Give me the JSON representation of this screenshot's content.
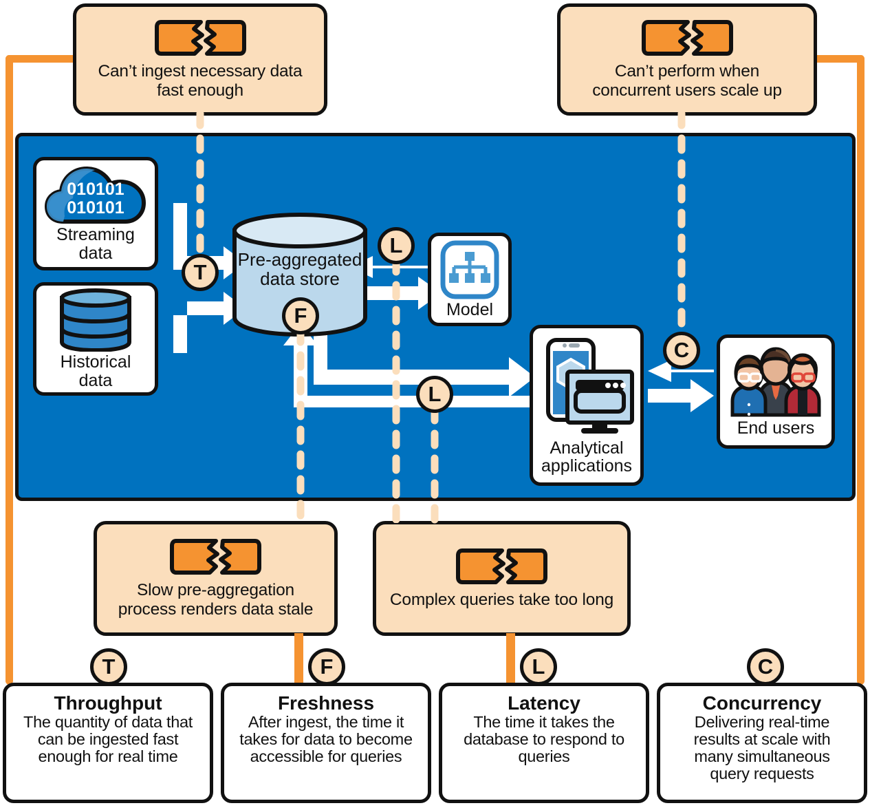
{
  "colors": {
    "orange": "#F59331",
    "peach": "#FBDEBC",
    "blue": "#0072BF",
    "light_blue": "#BBD8EC",
    "ink": "#111111",
    "icon_blue": "#4A90C4"
  },
  "problem_callouts": [
    {
      "id": "ingest",
      "icon": "broken-brick-icon",
      "text": "Can’t ingest necessary data\nfast enough"
    },
    {
      "id": "concurrency",
      "icon": "broken-brick-icon",
      "text": "Can’t perform when\nconcurrent users scale up"
    },
    {
      "id": "preaggregation",
      "icon": "broken-brick-icon",
      "text": "Slow pre-aggregation\nprocess renders data stale"
    },
    {
      "id": "queries",
      "icon": "broken-brick-icon",
      "text": "Complex queries take too long"
    }
  ],
  "architecture": {
    "nodes": [
      {
        "id": "streaming",
        "icon": "cloud-data-icon",
        "label": "Streaming\ndata",
        "binary_text_line1": "010101",
        "binary_text_line2": "010101"
      },
      {
        "id": "historical",
        "icon": "database-icon",
        "label": "Historical\ndata"
      },
      {
        "id": "datastore",
        "icon": "cylinder-icon",
        "label": "Pre-aggregated\ndata store"
      },
      {
        "id": "model",
        "icon": "hierarchy-icon",
        "label": "Model"
      },
      {
        "id": "apps",
        "icon": "devices-icon",
        "label": "Analytical\napplications"
      },
      {
        "id": "endusers",
        "icon": "people-group-icon",
        "label": "End users"
      }
    ]
  },
  "badges": [
    {
      "id": "t-ingest",
      "letter": "T"
    },
    {
      "id": "l-model",
      "letter": "L"
    },
    {
      "id": "f-store",
      "letter": "F"
    },
    {
      "id": "l-apps",
      "letter": "L"
    },
    {
      "id": "c-users",
      "letter": "C"
    },
    {
      "id": "t-card",
      "letter": "T"
    },
    {
      "id": "f-card",
      "letter": "F"
    },
    {
      "id": "l-card",
      "letter": "L"
    },
    {
      "id": "c-card",
      "letter": "C"
    }
  ],
  "definitions": [
    {
      "id": "throughput",
      "letter": "T",
      "title": "Throughput",
      "description": "The quantity of data that\ncan be ingested fast\nenough for real time"
    },
    {
      "id": "freshness",
      "letter": "F",
      "title": "Freshness",
      "description": "After ingest, the time it\ntakes for data to become\naccessible for queries"
    },
    {
      "id": "latency",
      "letter": "L",
      "title": "Latency",
      "description": "The time it takes the\ndatabase to respond to\nqueries"
    },
    {
      "id": "concurrency",
      "letter": "C",
      "title": "Concurrency",
      "description": "Delivering real-time\nresults at scale with\nmany simultaneous\nquery requests"
    }
  ]
}
